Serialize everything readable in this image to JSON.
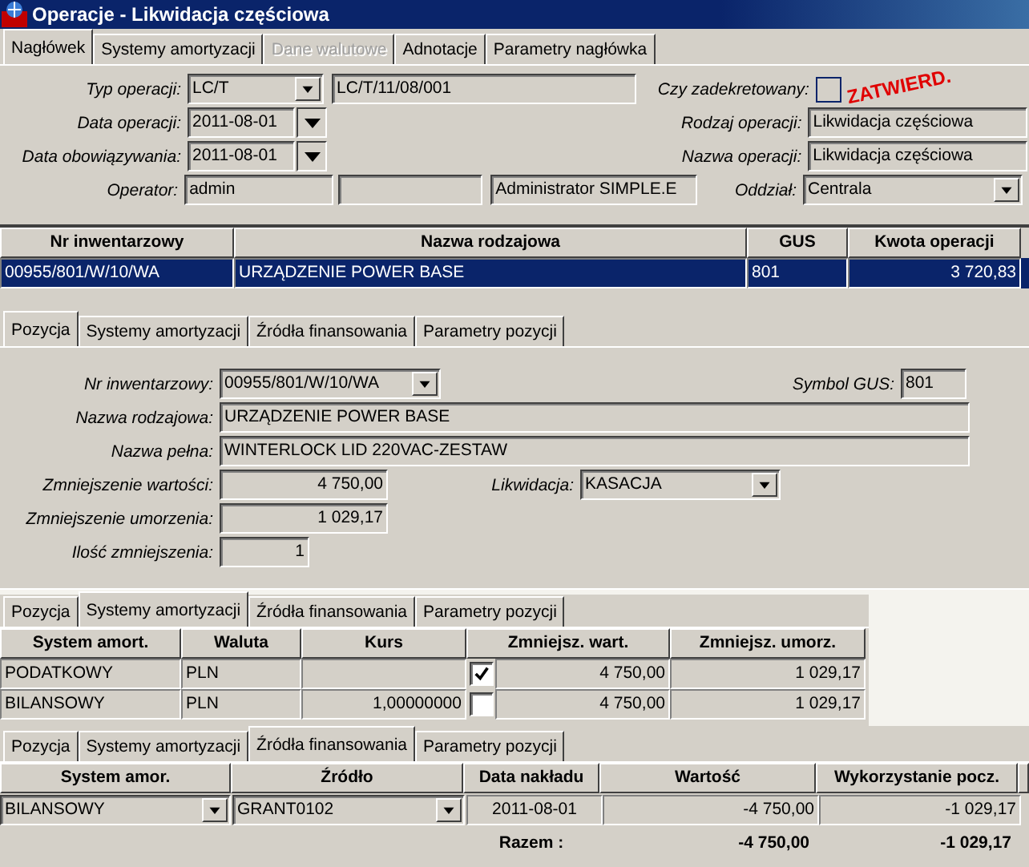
{
  "window": {
    "title": "Operacje - Likwidacja częściowa"
  },
  "tabs": [
    {
      "label": "Nagłówek",
      "selected": true,
      "disabled": false
    },
    {
      "label": "Systemy amortyzacji",
      "selected": false,
      "disabled": false
    },
    {
      "label": "Dane walutowe",
      "selected": false,
      "disabled": true
    },
    {
      "label": "Adnotacje",
      "selected": false,
      "disabled": false
    },
    {
      "label": "Parametry nagłówka",
      "selected": false,
      "disabled": false
    }
  ],
  "header": {
    "typ_operacji": {
      "label": "Typ operacji:",
      "value": "LC/T",
      "number": "LC/T/11/08/001"
    },
    "data_operacji": {
      "label": "Data operacji:",
      "value": "2011-08-01"
    },
    "data_obowiazywania": {
      "label": "Data obowiązywania:",
      "value": "2011-08-01"
    },
    "operator": {
      "label": "Operator:",
      "login": "admin",
      "name": "Administrator SIMPLE.E"
    },
    "czy_zadekretowany": {
      "label": "Czy zadekretowany:",
      "checked": false
    },
    "rodzaj_operacji": {
      "label": "Rodzaj operacji:",
      "value": "Likwidacja częściowa"
    },
    "nazwa_operacji": {
      "label": "Nazwa operacji:",
      "value": "Likwidacja częściowa"
    },
    "oddzial": {
      "label": "Oddział:",
      "value": "Centrala"
    },
    "stamp": "ZATWIERD."
  },
  "items_table": {
    "columns": [
      "Nr inwentarzowy",
      "Nazwa rodzajowa",
      "GUS",
      "Kwota operacji"
    ],
    "rows": [
      {
        "cells": [
          "00955/801/W/10/WA",
          "URZĄDZENIE POWER BASE",
          "801",
          "3 720,83"
        ],
        "selected": true
      }
    ]
  },
  "position_tabs": [
    {
      "label": "Pozycja",
      "selected": true
    },
    {
      "label": "Systemy amortyzacji",
      "selected": false
    },
    {
      "label": "Źródła finansowania",
      "selected": false
    },
    {
      "label": "Parametry pozycji",
      "selected": false
    }
  ],
  "position": {
    "nr_inwentarzowy": {
      "label": "Nr inwentarzowy:",
      "value": "00955/801/W/10/WA"
    },
    "symbol_gus": {
      "label": "Symbol GUS:",
      "value": "801"
    },
    "nazwa_rodzajowa": {
      "label": "Nazwa rodzajowa:",
      "value": "URZĄDZENIE POWER BASE"
    },
    "nazwa_pelna": {
      "label": "Nazwa pełna:",
      "value": "WINTERLOCK LID 220VAC-ZESTAW"
    },
    "zmniejszenie_wartosci": {
      "label": "Zmniejszenie wartości:",
      "value": "4 750,00"
    },
    "likwidacja": {
      "label": "Likwidacja:",
      "value": "KASACJA"
    },
    "zmniejszenie_umorzenia": {
      "label": "Zmniejszenie umorzenia:",
      "value": "1 029,17"
    },
    "ilosc_zmniejszenia": {
      "label": "Ilość zmniejszenia:",
      "value": "1"
    }
  },
  "amortization": {
    "tabs": [
      {
        "label": "Pozycja",
        "selected": false
      },
      {
        "label": "Systemy amortyzacji",
        "selected": true
      },
      {
        "label": "Źródła finansowania",
        "selected": false
      },
      {
        "label": "Parametry pozycji",
        "selected": false
      }
    ],
    "columns": [
      "System amort.",
      "Waluta",
      "Kurs",
      "Zmniejsz. wart.",
      "Zmniejsz. umorz."
    ],
    "rows": [
      {
        "system": "PODATKOWY",
        "waluta": "PLN",
        "checked": true,
        "zmniejsz_wart": "4 750,00",
        "zmniejsz_umorz": "1 029,17"
      },
      {
        "system": "BILANSOWY",
        "waluta": "PLN",
        "kurs": "1,00000000",
        "checked": false,
        "zmniejsz_wart": "4 750,00",
        "zmniejsz_umorz": "1 029,17"
      }
    ]
  },
  "financing": {
    "tabs": [
      {
        "label": "Pozycja",
        "selected": false
      },
      {
        "label": "Systemy amortyzacji",
        "selected": false
      },
      {
        "label": "Źródła finansowania",
        "selected": true
      },
      {
        "label": "Parametry pozycji",
        "selected": false
      }
    ],
    "columns": [
      "System amor.",
      "Źródło",
      "Data nakładu",
      "Wartość",
      "Wykorzystanie pocz."
    ],
    "rows": [
      {
        "system": "BILANSOWY",
        "zrodlo": "GRANT0102",
        "data": "2011-08-01",
        "wartosc": "-4 750,00",
        "wykorzystanie": "-1 029,17"
      }
    ],
    "totals": {
      "label": "Razem :",
      "wartosc": "-4 750,00",
      "wykorzystanie": "-1 029,17"
    }
  }
}
